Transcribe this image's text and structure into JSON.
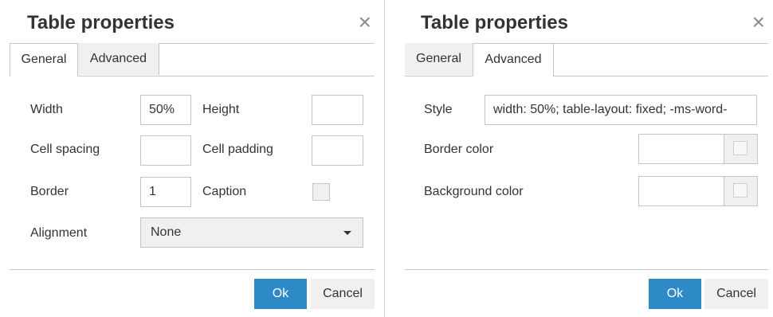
{
  "left_dialog": {
    "title": "Table properties",
    "close_icon": "×",
    "tabs": [
      "General",
      "Advanced"
    ],
    "active_tab": "General",
    "fields": {
      "width_label": "Width",
      "width_value": "50%",
      "height_label": "Height",
      "height_value": "",
      "cell_spacing_label": "Cell spacing",
      "cell_spacing_value": "",
      "cell_padding_label": "Cell padding",
      "cell_padding_value": "",
      "border_label": "Border",
      "border_value": "1",
      "caption_label": "Caption",
      "caption_checked": false,
      "alignment_label": "Alignment",
      "alignment_value": "None"
    },
    "ok_label": "Ok",
    "cancel_label": "Cancel"
  },
  "right_dialog": {
    "title": "Table properties",
    "close_icon": "×",
    "tabs": [
      "General",
      "Advanced"
    ],
    "active_tab": "Advanced",
    "fields": {
      "style_label": "Style",
      "style_value": "width: 50%; table-layout: fixed; -ms-word-",
      "border_color_label": "Border color",
      "border_color_value": "",
      "background_color_label": "Background color",
      "background_color_value": ""
    },
    "ok_label": "Ok",
    "cancel_label": "Cancel"
  },
  "colors": {
    "accent": "#2d8ac7",
    "border": "#c5c5c5",
    "tab_inactive": "#f0f0f0"
  }
}
